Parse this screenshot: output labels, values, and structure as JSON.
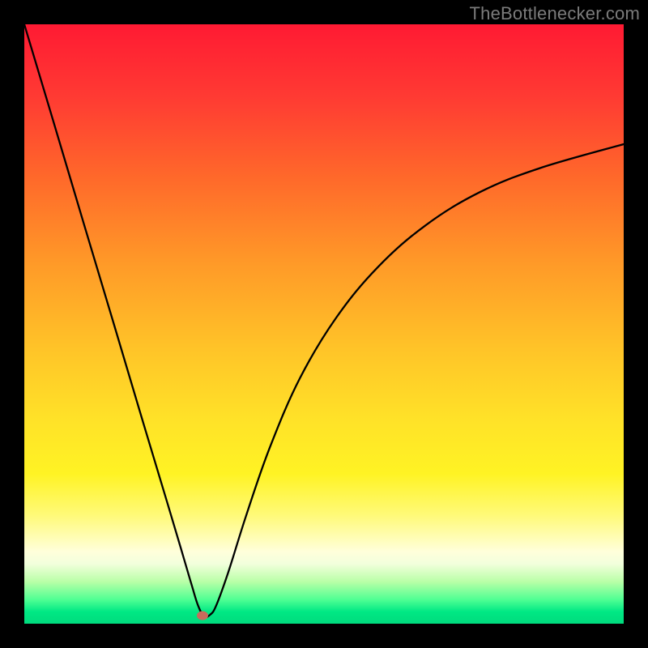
{
  "watermark": "TheBottlenecker.com",
  "marker": {
    "x_frac": 0.297,
    "y_frac": 0.986
  },
  "chart_data": {
    "type": "line",
    "title": "",
    "xlabel": "",
    "ylabel": "",
    "xlim": [
      0,
      1
    ],
    "ylim": [
      0,
      1
    ],
    "series": [
      {
        "name": "bottleneck-curve",
        "x": [
          0.0,
          0.05,
          0.1,
          0.15,
          0.2,
          0.24,
          0.265,
          0.28,
          0.29,
          0.3,
          0.31,
          0.32,
          0.34,
          0.37,
          0.41,
          0.46,
          0.52,
          0.59,
          0.67,
          0.76,
          0.86,
          1.0
        ],
        "y": [
          1.0,
          0.833,
          0.665,
          0.498,
          0.33,
          0.197,
          0.113,
          0.062,
          0.03,
          0.012,
          0.015,
          0.03,
          0.085,
          0.18,
          0.295,
          0.41,
          0.51,
          0.595,
          0.665,
          0.72,
          0.76,
          0.8
        ]
      }
    ],
    "marker_point": {
      "x": 0.297,
      "y": 0.014
    },
    "gradient_stops": [
      {
        "pos": 0.0,
        "color": "#ff1a33"
      },
      {
        "pos": 0.55,
        "color": "#ffe228"
      },
      {
        "pos": 0.88,
        "color": "#ffffdb"
      },
      {
        "pos": 1.0,
        "color": "#00db7d"
      }
    ]
  }
}
